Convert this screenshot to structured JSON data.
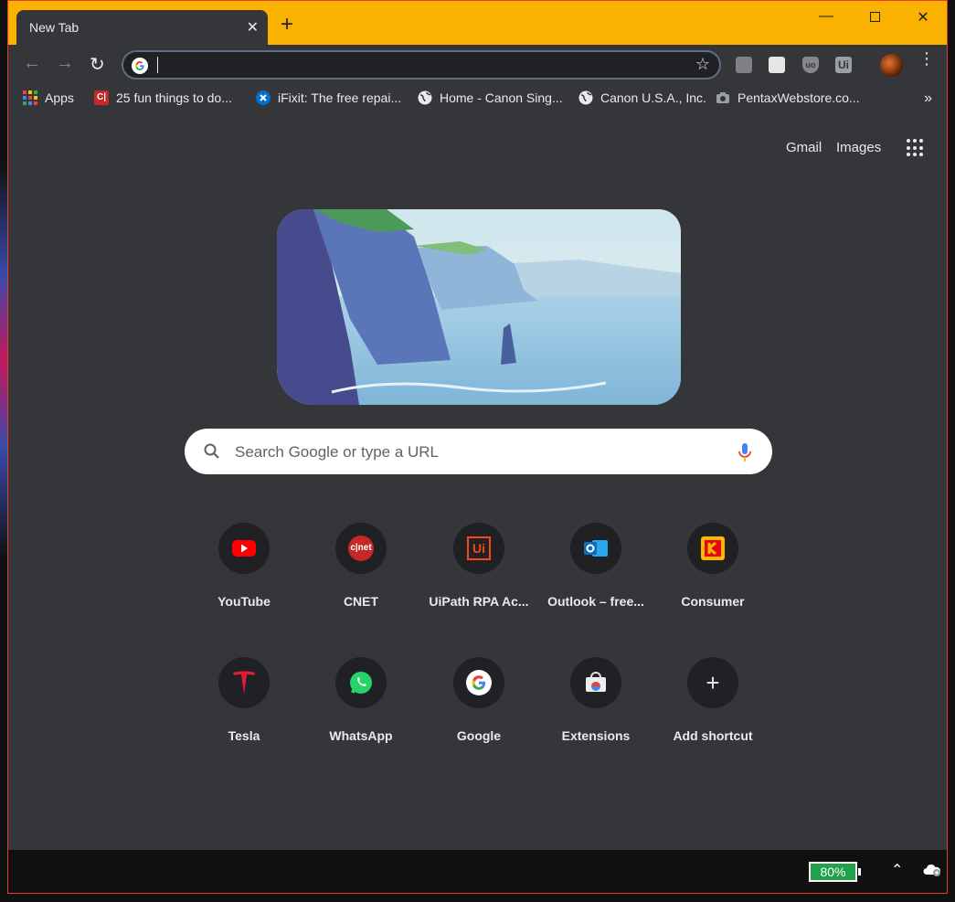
{
  "tab": {
    "title": "New Tab",
    "close_glyph": "✕",
    "new_glyph": "+"
  },
  "window_controls": {
    "minimize": "—",
    "close": "✕"
  },
  "toolbar": {
    "back_glyph": "←",
    "forward_glyph": "→",
    "reload_glyph": "↻",
    "omnibox_value": "",
    "star_glyph": "☆",
    "extensions": [
      "gray-extension-icon",
      "white-extension-icon",
      "ublock-origin-icon",
      "uipath-extension-icon"
    ],
    "ext3_text": "uo",
    "ext4_text": "Ui",
    "menu_glyph": "⋮"
  },
  "bookmarks": {
    "items": [
      {
        "label": "Apps",
        "icon": "apps-grid-icon"
      },
      {
        "label": "25 fun things to do...",
        "icon": "cnet-favicon"
      },
      {
        "label": "iFixit: The free repai...",
        "icon": "ifixit-favicon"
      },
      {
        "label": "Home - Canon Sing...",
        "icon": "globe-icon"
      },
      {
        "label": "Canon U.S.A., Inc.",
        "icon": "globe-icon"
      },
      {
        "label": "PentaxWebstore.co...",
        "icon": "camera-favicon"
      }
    ],
    "more_glyph": "»"
  },
  "main": {
    "gmail": "Gmail",
    "images": "Images",
    "search_placeholder": "Search Google or type a URL",
    "shortcuts": [
      {
        "label": "YouTube",
        "icon": "youtube-icon"
      },
      {
        "label": "CNET",
        "icon": "cnet-icon"
      },
      {
        "label": "UiPath RPA Ac...",
        "icon": "uipath-icon"
      },
      {
        "label": "Outlook – free...",
        "icon": "outlook-icon"
      },
      {
        "label": "Consumer",
        "icon": "kodak-icon"
      },
      {
        "label": "Tesla",
        "icon": "tesla-icon"
      },
      {
        "label": "WhatsApp",
        "icon": "whatsapp-icon"
      },
      {
        "label": "Google",
        "icon": "google-icon"
      },
      {
        "label": "Extensions",
        "icon": "chrome-web-store-icon"
      },
      {
        "label": "Add shortcut",
        "icon": "plus-icon"
      }
    ],
    "cnet_text": "c|net",
    "uipath_text": "Ui",
    "add_glyph": "+"
  },
  "taskbar": {
    "battery": "80%",
    "tray_up_glyph": "⌃"
  },
  "colors": {
    "titlebar": "#fbb100",
    "background": "#35363a",
    "accent": "#8ab4f8"
  }
}
